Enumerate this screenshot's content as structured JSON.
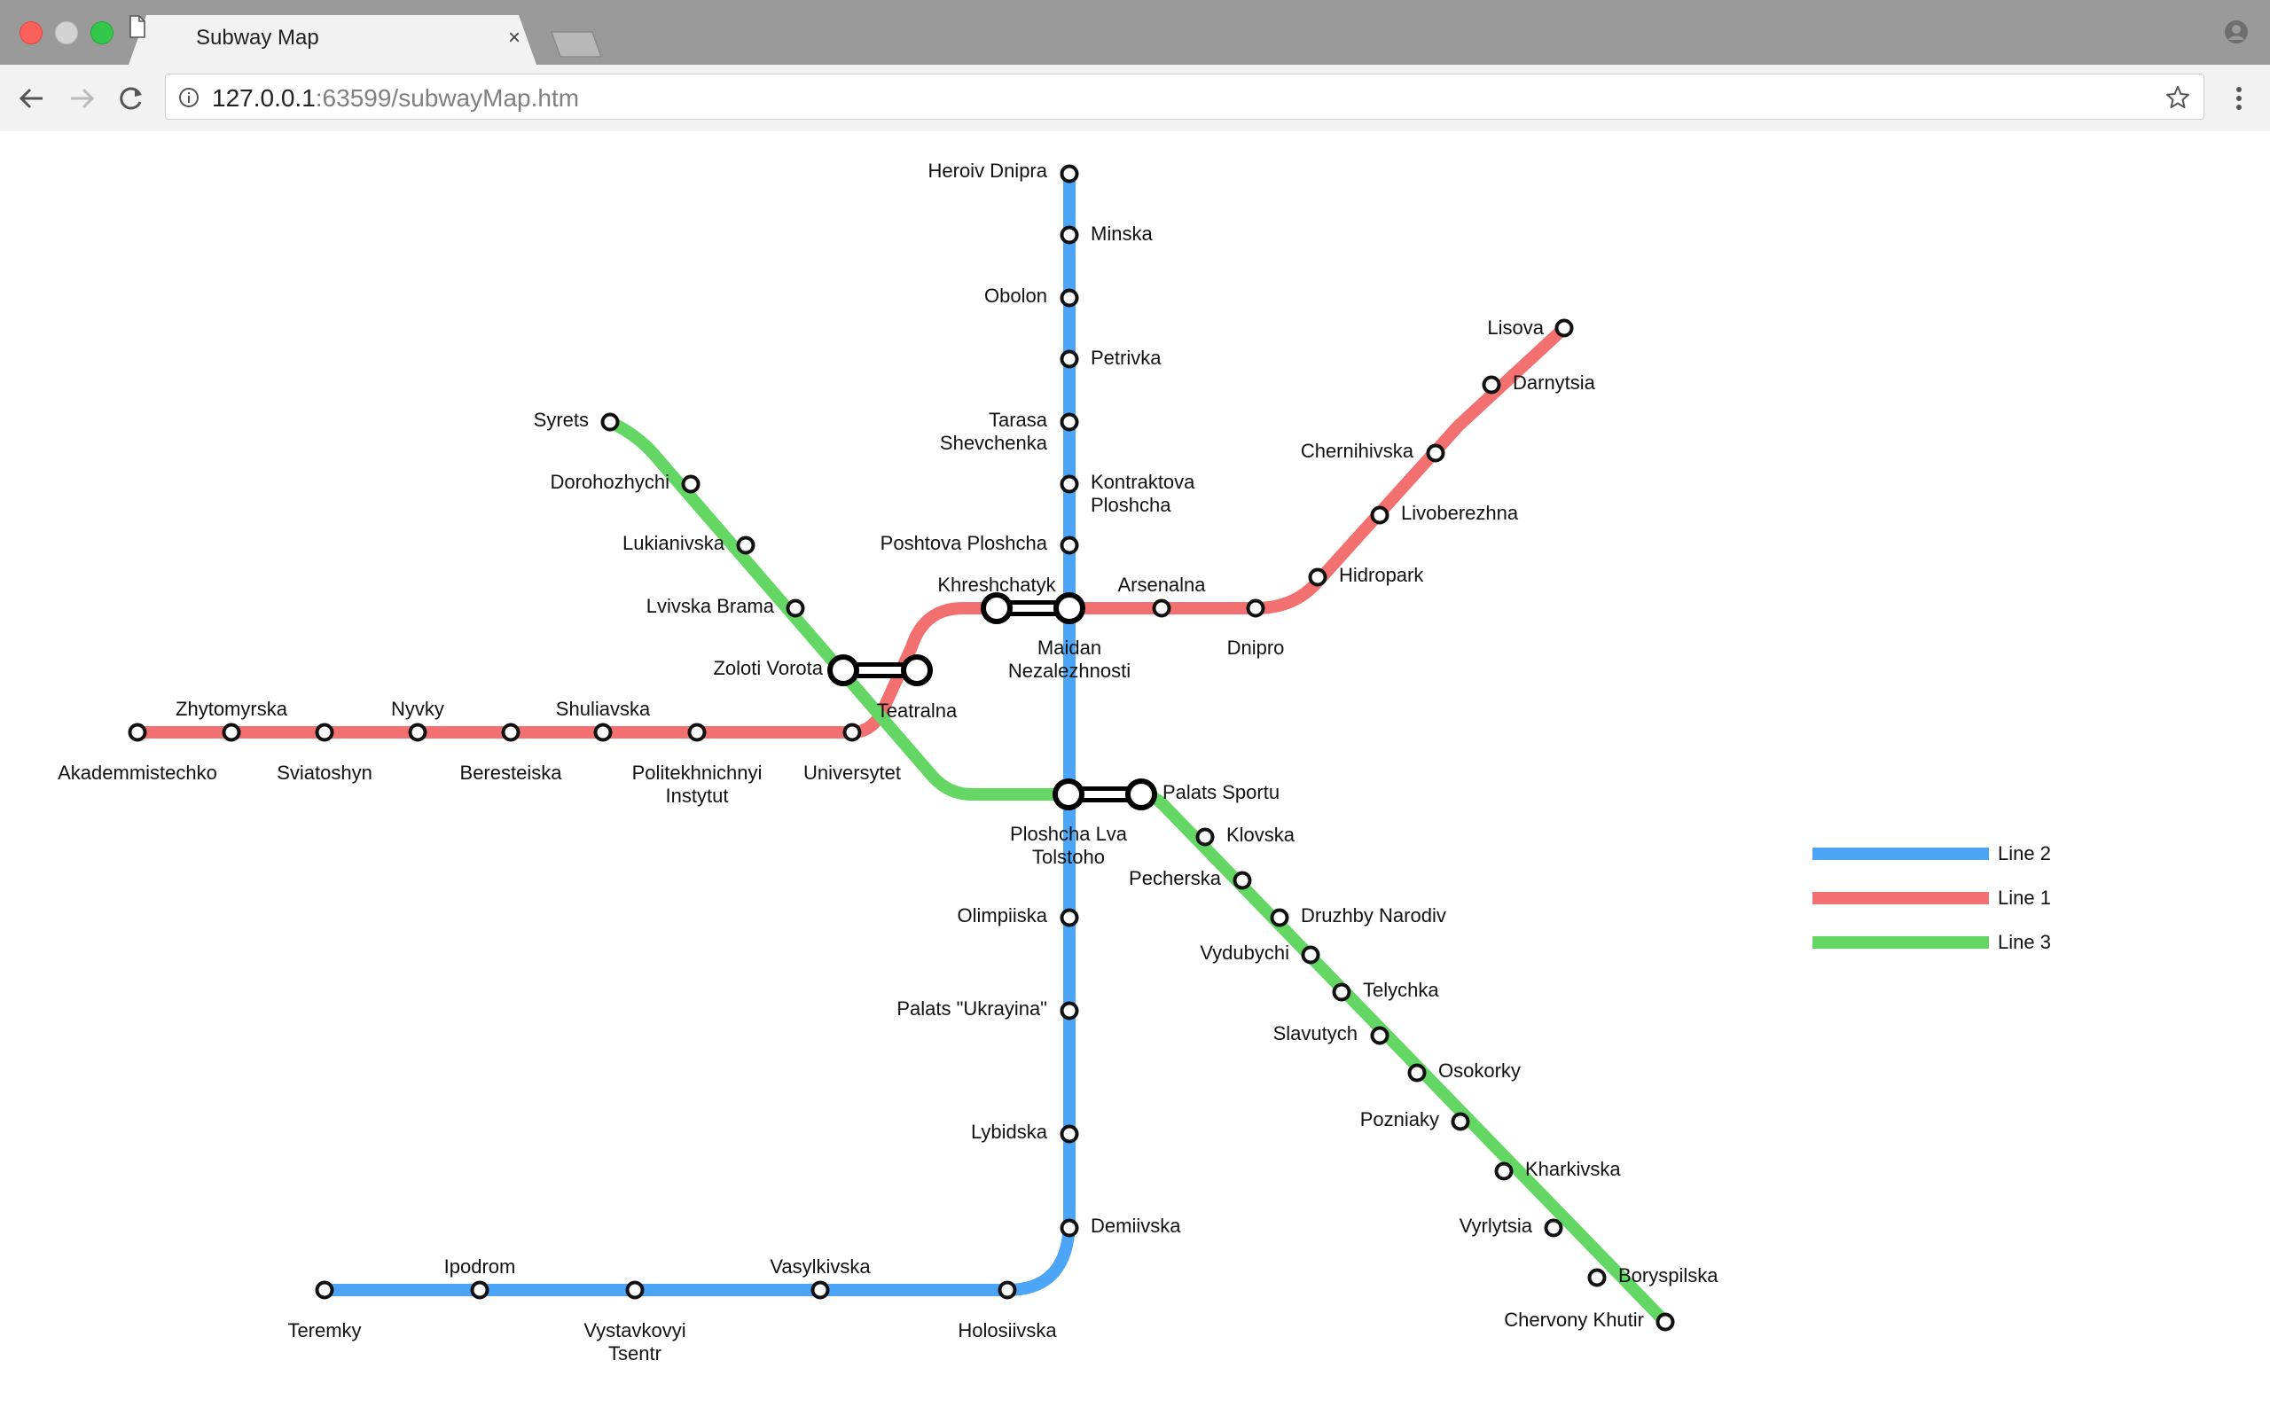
{
  "browser": {
    "tab_title": "Subway Map",
    "tab_close": "×",
    "url_host": "127.0.0.1",
    "url_rest": ":63599/subwayMap.htm"
  },
  "legend": [
    {
      "name": "Line 2",
      "color": "#4da5f7"
    },
    {
      "name": "Line 1",
      "color": "#f27070"
    },
    {
      "name": "Line 3",
      "color": "#64d664"
    }
  ],
  "stations": [
    {
      "id": "heroiv_dnipra",
      "label": [
        "Heroiv Dnipra"
      ]
    },
    {
      "id": "minska",
      "label": [
        "Minska"
      ]
    },
    {
      "id": "obolon",
      "label": [
        "Obolon"
      ]
    },
    {
      "id": "petrivka",
      "label": [
        "Petrivka"
      ]
    },
    {
      "id": "tarasa",
      "label": [
        "Tarasa",
        "Shevchenka"
      ]
    },
    {
      "id": "kontraktova",
      "label": [
        "Kontraktova",
        "Ploshcha"
      ]
    },
    {
      "id": "poshtova",
      "label": [
        "Poshtova Ploshcha"
      ]
    },
    {
      "id": "maidan",
      "label": [
        "Maidan",
        "Nezalezhnosti"
      ]
    },
    {
      "id": "ploshcha_lva",
      "label": [
        "Ploshcha Lva",
        "Tolstoho"
      ]
    },
    {
      "id": "olimpiiska",
      "label": [
        "Olimpiiska"
      ]
    },
    {
      "id": "palats_ukrayina",
      "label": [
        "Palats \"Ukrayina\""
      ]
    },
    {
      "id": "lybidska",
      "label": [
        "Lybidska"
      ]
    },
    {
      "id": "demiivska",
      "label": [
        "Demiivska"
      ]
    },
    {
      "id": "holosiivska",
      "label": [
        "Holosiivska"
      ]
    },
    {
      "id": "vasylkivska",
      "label": [
        "Vasylkivska"
      ]
    },
    {
      "id": "vystavkovyi",
      "label": [
        "Vystavkovyi",
        "Tsentr"
      ]
    },
    {
      "id": "ipodrom",
      "label": [
        "Ipodrom"
      ]
    },
    {
      "id": "teremky",
      "label": [
        "Teremky"
      ]
    },
    {
      "id": "akademmistechko",
      "label": [
        "Akademmistechko"
      ]
    },
    {
      "id": "zhytomyrska",
      "label": [
        "Zhytomyrska"
      ]
    },
    {
      "id": "sviatoshyn",
      "label": [
        "Sviatoshyn"
      ]
    },
    {
      "id": "nyvky",
      "label": [
        "Nyvky"
      ]
    },
    {
      "id": "beresteiska",
      "label": [
        "Beresteiska"
      ]
    },
    {
      "id": "shuliavska",
      "label": [
        "Shuliavska"
      ]
    },
    {
      "id": "politekhnichnyi",
      "label": [
        "Politekhnichnyi",
        "Instytut"
      ]
    },
    {
      "id": "universytet",
      "label": [
        "Universytet"
      ]
    },
    {
      "id": "teatralna",
      "label": [
        "Teatralna"
      ]
    },
    {
      "id": "khreshchatyk",
      "label": [
        "Khreshchatyk"
      ]
    },
    {
      "id": "arsenalna",
      "label": [
        "Arsenalna"
      ]
    },
    {
      "id": "dnipro",
      "label": [
        "Dnipro"
      ]
    },
    {
      "id": "hidropark",
      "label": [
        "Hidropark"
      ]
    },
    {
      "id": "livoberezhna",
      "label": [
        "Livoberezhna"
      ]
    },
    {
      "id": "darnytsia",
      "label": [
        "Darnytsia"
      ]
    },
    {
      "id": "chernihivska",
      "label": [
        "Chernihivska"
      ]
    },
    {
      "id": "lisova",
      "label": [
        "Lisova"
      ]
    },
    {
      "id": "syrets",
      "label": [
        "Syrets"
      ]
    },
    {
      "id": "dorohozhychi",
      "label": [
        "Dorohozhychi"
      ]
    },
    {
      "id": "lukianivska",
      "label": [
        "Lukianivska"
      ]
    },
    {
      "id": "lvivska_brama",
      "label": [
        "Lvivska Brama"
      ]
    },
    {
      "id": "zoloti_vorota",
      "label": [
        "Zoloti Vorota"
      ]
    },
    {
      "id": "palats_sportu",
      "label": [
        "Palats Sportu"
      ]
    },
    {
      "id": "klovska",
      "label": [
        "Klovska"
      ]
    },
    {
      "id": "pecherska",
      "label": [
        "Pecherska"
      ]
    },
    {
      "id": "druzhby",
      "label": [
        "Druzhby Narodiv"
      ]
    },
    {
      "id": "vydubychi",
      "label": [
        "Vydubychi"
      ]
    },
    {
      "id": "telychka",
      "label": [
        "Telychka"
      ]
    },
    {
      "id": "slavutych",
      "label": [
        "Slavutych"
      ]
    },
    {
      "id": "osokorky",
      "label": [
        "Osokorky"
      ]
    },
    {
      "id": "pozniaky",
      "label": [
        "Pozniaky"
      ]
    },
    {
      "id": "kharkivska",
      "label": [
        "Kharkivska"
      ]
    },
    {
      "id": "vyrlytsia",
      "label": [
        "Vyrlytsia"
      ]
    },
    {
      "id": "boryspilska",
      "label": [
        "Boryspilska"
      ]
    },
    {
      "id": "chervony_khutir",
      "label": [
        "Chervony Khutir"
      ]
    }
  ]
}
